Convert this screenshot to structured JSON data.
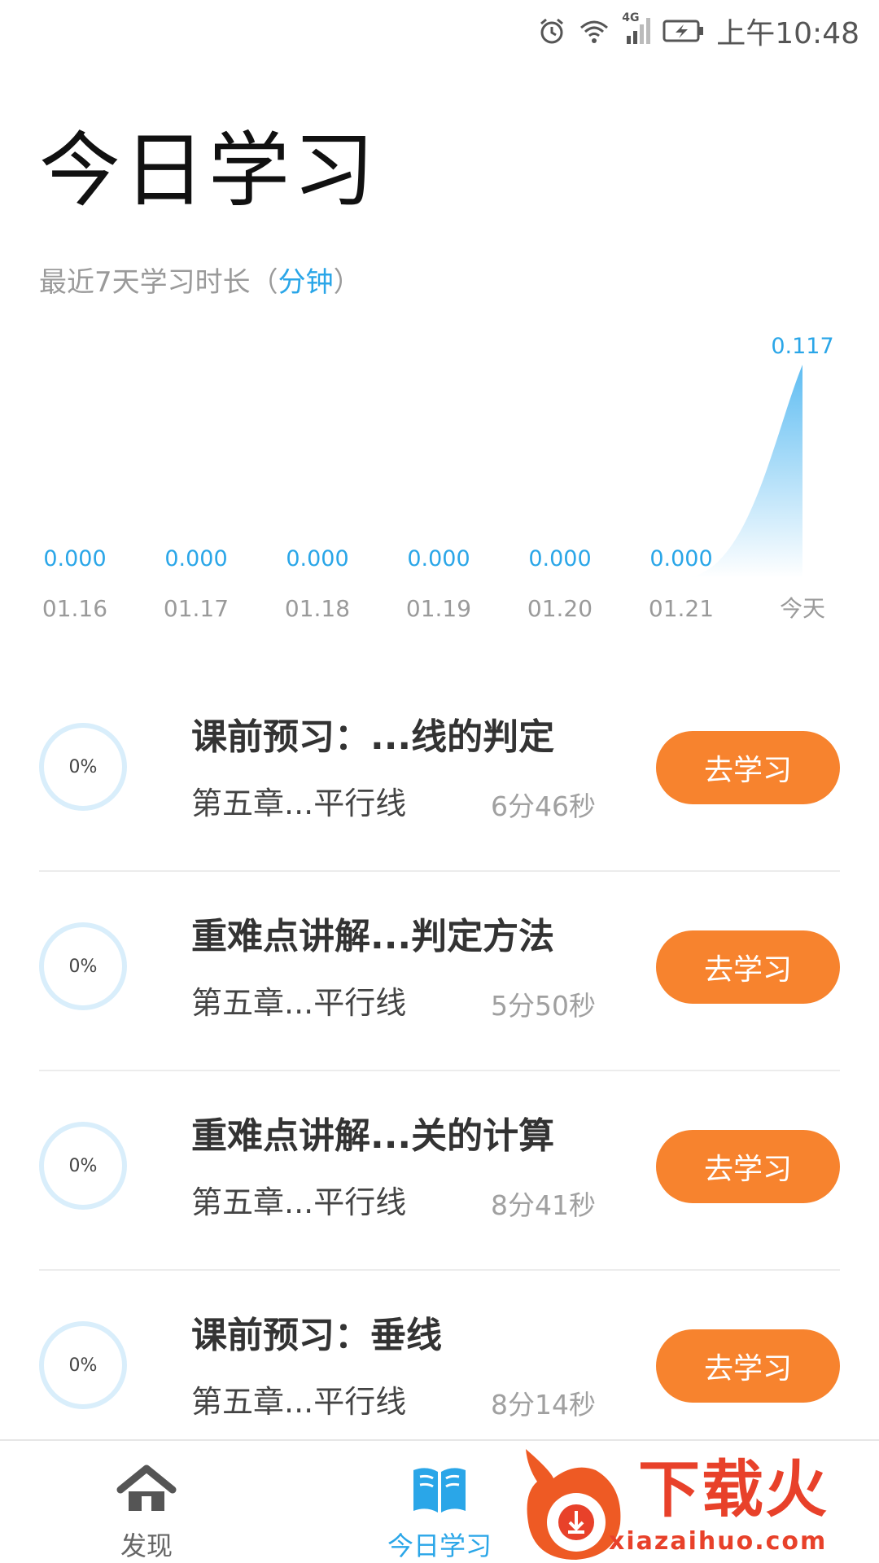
{
  "status_bar": {
    "time": "上午10:48",
    "network": "4G",
    "icons": [
      "alarm-icon",
      "wifi-icon",
      "signal-icon",
      "battery-charging-icon"
    ]
  },
  "page": {
    "title": "今日学习",
    "caption_prefix": "最近7天学习时长（",
    "caption_unit": "分钟",
    "caption_suffix": "）"
  },
  "chart_data": {
    "type": "area",
    "title": "",
    "x": [
      "01.16",
      "01.17",
      "01.18",
      "01.19",
      "01.20",
      "01.21",
      "今天"
    ],
    "values": [
      0.0,
      0.0,
      0.0,
      0.0,
      0.0,
      0.0,
      0.117
    ],
    "value_labels": [
      "0.000",
      "0.000",
      "0.000",
      "0.000",
      "0.000",
      "0.000",
      "0.117"
    ],
    "ylim": [
      0,
      0.117
    ],
    "grid": false,
    "colors": {
      "value_label": "#2aa6e8",
      "area_top": "#5fbdf2",
      "area_bottom": "#ffffff",
      "tick": "#9a9a9a"
    }
  },
  "lessons": [
    {
      "progress": "0%",
      "progress_value": 0,
      "title": "课前预习：...线的判定",
      "chapter": "第五章...平行线",
      "duration": "6分46秒",
      "button": "去学习"
    },
    {
      "progress": "0%",
      "progress_value": 0,
      "title": "重难点讲解...判定方法",
      "chapter": "第五章...平行线",
      "duration": "5分50秒",
      "button": "去学习"
    },
    {
      "progress": "0%",
      "progress_value": 0,
      "title": "重难点讲解...关的计算",
      "chapter": "第五章...平行线",
      "duration": "8分41秒",
      "button": "去学习"
    },
    {
      "progress": "0%",
      "progress_value": 0,
      "title": "课前预习：垂线",
      "chapter": "第五章...平行线",
      "duration": "8分14秒",
      "button": "去学习"
    }
  ],
  "bottom_nav": {
    "items": [
      {
        "label": "发现",
        "icon": "home-icon",
        "active": false
      },
      {
        "label": "今日学习",
        "icon": "book-icon",
        "active": true
      }
    ]
  },
  "watermark": {
    "text": "下载火",
    "domain": "xiazaihuo.com",
    "icon": "flame-logo-icon"
  },
  "colors": {
    "accent": "#2aa6e8",
    "button": "#f7832e",
    "ring": "#d9eefb",
    "watermark": "#e8412a"
  }
}
